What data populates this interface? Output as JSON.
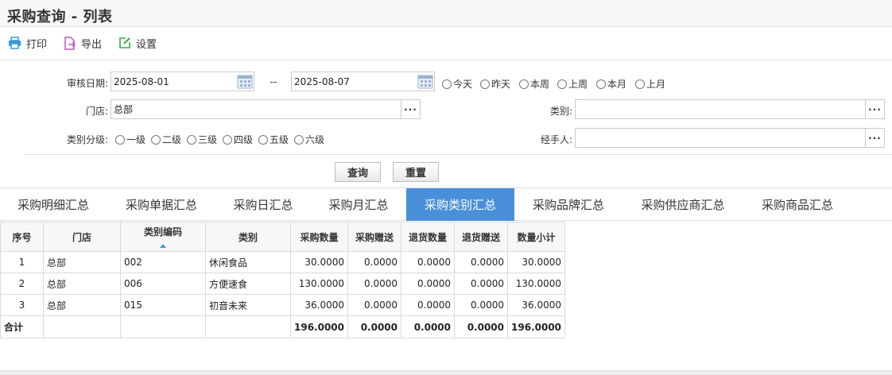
{
  "header": {
    "title": "采购查询 - 列表"
  },
  "toolbar": {
    "print": "打印",
    "export": "导出",
    "settings": "设置"
  },
  "filters": {
    "audit_date_label": "审核日期:",
    "date_from": "2025-08-01",
    "date_sep": "--",
    "date_to": "2025-08-07",
    "quick_ranges": [
      "今天",
      "昨天",
      "本周",
      "上周",
      "本月",
      "上月"
    ],
    "store_label": "门店:",
    "store_value": "总部",
    "category_label": "类别:",
    "category_value": "",
    "level_label": "类别分级:",
    "levels": [
      "一级",
      "二级",
      "三级",
      "四级",
      "五级",
      "六级"
    ],
    "handler_label": "经手人:",
    "handler_value": "",
    "more": "···"
  },
  "actions": {
    "query": "查询",
    "reset": "重置"
  },
  "tabs": [
    "采购明细汇总",
    "采购单据汇总",
    "采购日汇总",
    "采购月汇总",
    "采购类别汇总",
    "采购品牌汇总",
    "采购供应商汇总",
    "采购商品汇总"
  ],
  "active_tab": 4,
  "table": {
    "columns": [
      "序号",
      "门店",
      "类别编码",
      "类别",
      "采购数量",
      "采购赠送",
      "退货数量",
      "退货赠送",
      "数量小计"
    ],
    "rows": [
      [
        "1",
        "总部",
        "002",
        "休闲食品",
        "30.0000",
        "0.0000",
        "0.0000",
        "0.0000",
        "30.0000"
      ],
      [
        "2",
        "总部",
        "006",
        "方便速食",
        "130.0000",
        "0.0000",
        "0.0000",
        "0.0000",
        "130.0000"
      ],
      [
        "3",
        "总部",
        "015",
        "初音未来",
        "36.0000",
        "0.0000",
        "0.0000",
        "0.0000",
        "36.0000"
      ]
    ],
    "total": [
      "合计",
      "",
      "",
      "",
      "196.0000",
      "0.0000",
      "0.0000",
      "0.0000",
      "196.0000"
    ]
  },
  "colors": {
    "accent": "#4a8fd9",
    "print_icon": "#3a9ad9",
    "export_icon": "#c056c0",
    "settings_icon": "#3aa84a"
  }
}
